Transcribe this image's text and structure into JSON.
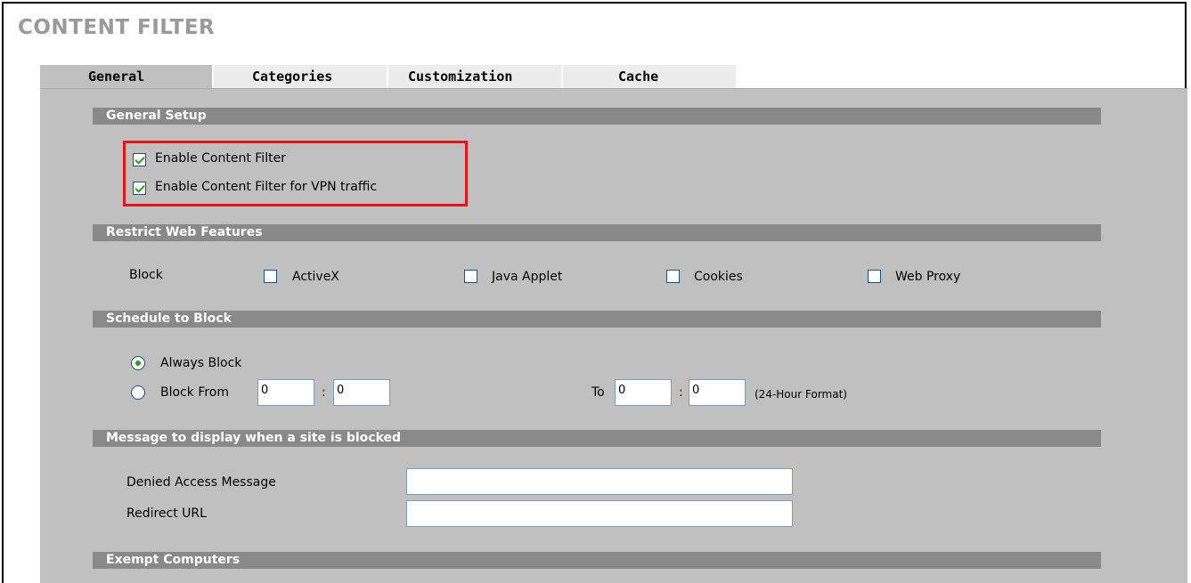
{
  "page": {
    "title": "CONTENT FILTER"
  },
  "tabs": [
    {
      "label": "General",
      "active": true
    },
    {
      "label": "Categories",
      "active": false
    },
    {
      "label": "Customization",
      "active": false
    },
    {
      "label": "Cache",
      "active": false
    }
  ],
  "general_setup": {
    "header": "General Setup",
    "enable_content_filter": {
      "label": "Enable Content Filter",
      "checked": true
    },
    "enable_vpn_filter": {
      "label": "Enable Content Filter for VPN traffic",
      "checked": true
    }
  },
  "restrict_web": {
    "header": "Restrict Web Features",
    "block_label": "Block",
    "options": [
      {
        "label": "ActiveX",
        "checked": false
      },
      {
        "label": "Java Applet",
        "checked": false
      },
      {
        "label": "Cookies",
        "checked": false
      },
      {
        "label": "Web Proxy",
        "checked": false
      }
    ]
  },
  "schedule": {
    "header": "Schedule to Block",
    "always_block": {
      "label": "Always Block",
      "selected": true
    },
    "block_from": {
      "label": "Block From",
      "selected": false
    },
    "from_hour": "0",
    "from_minute": "0",
    "to_label": "To",
    "to_hour": "0",
    "to_minute": "0",
    "colon": ":",
    "format_note": "(24-Hour Format)"
  },
  "message": {
    "header": "Message to display when a site is blocked",
    "denied_label": "Denied Access Message",
    "denied_value": "",
    "redirect_label": "Redirect URL",
    "redirect_value": ""
  },
  "exempt": {
    "header": "Exempt Computers"
  },
  "colors": {
    "section_bar": "#898989",
    "panel": "#c0c0c0",
    "highlight": "#e5141b",
    "check": "#21a121"
  }
}
